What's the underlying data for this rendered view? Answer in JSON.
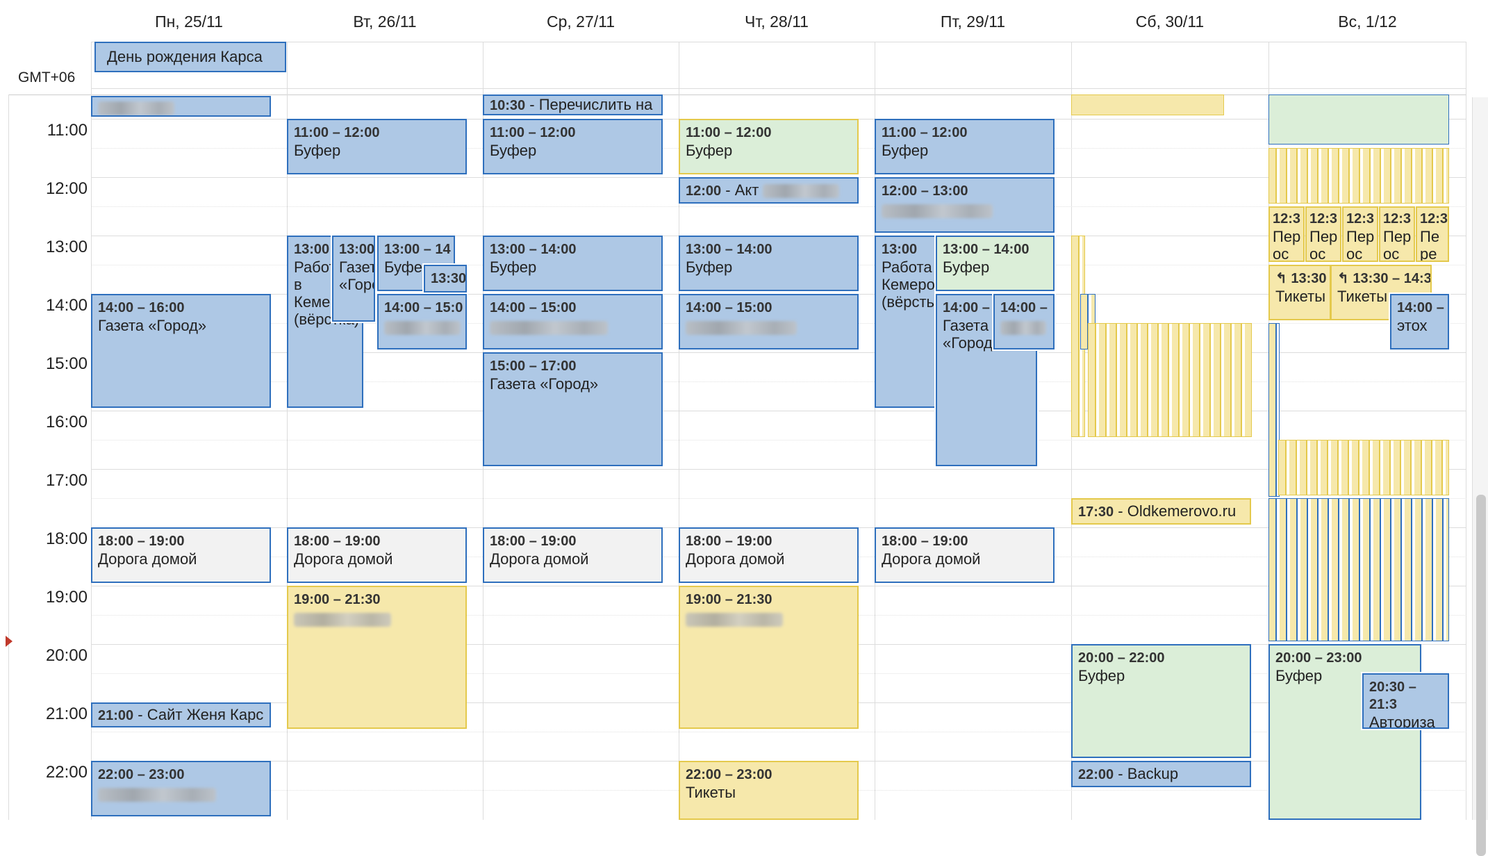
{
  "timezone": "GMT+06",
  "days": [
    "Пн, 25/11",
    "Вт, 26/11",
    "Ср, 27/11",
    "Чт, 28/11",
    "Пт, 29/11",
    "Сб, 30/11",
    "Вс, 1/12"
  ],
  "all_day": {
    "label": "День рождения Карса"
  },
  "hours": [
    "11:00",
    "12:00",
    "13:00",
    "14:00",
    "15:00",
    "16:00",
    "17:00",
    "18:00",
    "19:00",
    "20:00",
    "21:00",
    "22:00"
  ],
  "events": {
    "mon_1400": {
      "time": "14:00 – 16:00",
      "title": "Газета «Город»"
    },
    "mon_1800": {
      "time": "18:00 – 19:00",
      "title": "Дорога домой"
    },
    "mon_2100": {
      "time": "21:00",
      "title": "Сайт Женя Карс"
    },
    "mon_2200": {
      "time": "22:00 – 23:00"
    },
    "tue_1100": {
      "time": "11:00 – 12:00",
      "title": "Буфер"
    },
    "tue_1300a": {
      "time": "13:00",
      "title": "Работа в Кемерово (вёрстка)"
    },
    "tue_1300b": {
      "time": "13:00",
      "title": "Газета «Город»"
    },
    "tue_1300c": {
      "time": "13:00 – 14",
      "title": "Буфер"
    },
    "tue_1330": {
      "time": "13:30"
    },
    "tue_1400": {
      "time": "14:00 – 15:0"
    },
    "tue_1800": {
      "time": "18:00 – 19:00",
      "title": "Дорога домой"
    },
    "tue_1900": {
      "time": "19:00 – 21:30"
    },
    "wed_1030": {
      "time": "10:30",
      "title": "Перечислить на"
    },
    "wed_1100": {
      "time": "11:00 – 12:00",
      "title": "Буфер"
    },
    "wed_1300": {
      "time": "13:00 – 14:00",
      "title": "Буфер"
    },
    "wed_1400": {
      "time": "14:00 – 15:00"
    },
    "wed_1500": {
      "time": "15:00 – 17:00",
      "title": "Газета «Город»"
    },
    "wed_1800": {
      "time": "18:00 – 19:00",
      "title": "Дорога домой"
    },
    "thu_1100": {
      "time": "11:00 – 12:00",
      "title": "Буфер"
    },
    "thu_1200": {
      "time": "12:00",
      "title": "Акт"
    },
    "thu_1300": {
      "time": "13:00 – 14:00",
      "title": "Буфер"
    },
    "thu_1400": {
      "time": "14:00 – 15:00"
    },
    "thu_1800": {
      "time": "18:00 – 19:00",
      "title": "Дорога домой"
    },
    "thu_1900": {
      "time": "19:00 – 21:30"
    },
    "thu_2200": {
      "time": "22:00 – 23:00",
      "title": "Тикеты"
    },
    "fri_1100": {
      "time": "11:00 – 12:00",
      "title": "Буфер"
    },
    "fri_1200": {
      "time": "12:00 – 13:00"
    },
    "fri_1300a": {
      "time": "13:00",
      "title": "Работа Кемеро (вёрсть"
    },
    "fri_1300b": {
      "time": "13:00 – 14:00",
      "title": "Буфер"
    },
    "fri_1400a": {
      "time": "14:00 –",
      "title": "Газета «Город"
    },
    "fri_1400b": {
      "time": "14:00 –"
    },
    "fri_1800": {
      "time": "18:00 – 19:00",
      "title": "Дорога домой"
    },
    "sat_1730": {
      "time": "17:30",
      "title": "Oldkemerovo.ru"
    },
    "sat_2000": {
      "time": "20:00 – 22:00",
      "title": "Буфер"
    },
    "sat_2200": {
      "time": "22:00",
      "title": "Backup"
    },
    "sun_1230_1": {
      "time": "12:3",
      "title": "Пер ос"
    },
    "sun_1230_2": {
      "time": "12:3",
      "title": "Пер ос"
    },
    "sun_1230_3": {
      "time": "12:3",
      "title": "Пер ос"
    },
    "sun_1230_4": {
      "time": "12:3",
      "title": "Пер ос"
    },
    "sun_1230_5": {
      "time": "12:3",
      "title": "Пе ре"
    },
    "sun_1330a": {
      "time": "13:30",
      "title": "Тикеты"
    },
    "sun_1330b": {
      "time": "13:30 – 14:3",
      "title": "Тикеты"
    },
    "sun_1400": {
      "time": "14:00 –",
      "title": "этох"
    },
    "sun_2000": {
      "time": "20:00 – 23:00",
      "title": "Буфер"
    },
    "sun_2030": {
      "time": "20:30 – 21:3",
      "title": "Авториза ция"
    }
  },
  "colors": {
    "blue": "#aec8e5",
    "green": "#dbeed8",
    "yellow": "#f6e8ab",
    "gray": "#f2f2f2",
    "border_blue": "#2e6fbd",
    "border_yellow": "#e4c94c"
  }
}
